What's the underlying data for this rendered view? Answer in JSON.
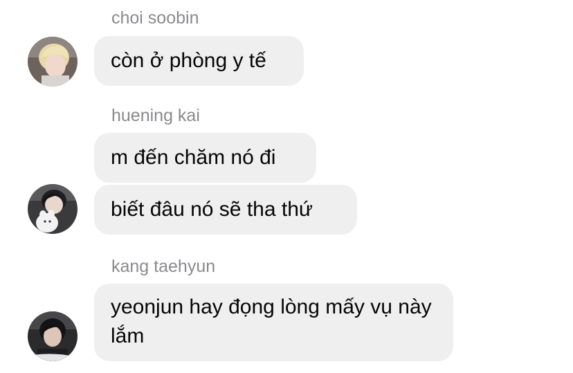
{
  "groups": [
    {
      "sender": "choi soobin",
      "messages": [
        "còn ở phòng y tế"
      ],
      "avatar": "user-avatar-photo"
    },
    {
      "sender": "huening kai",
      "messages": [
        "m đến chăm nó đi",
        "biết đâu nó sẽ tha thứ"
      ],
      "avatar": "user-avatar-photo"
    },
    {
      "sender": "kang taehyun",
      "messages": [
        "yeonjun hay đọng lòng mấy vụ này lắm"
      ],
      "avatar": "user-avatar-photo"
    }
  ],
  "colors": {
    "bubble": "#efeff0",
    "sender_name": "#8a8a8e",
    "message_text": "#050505",
    "background": "#ffffff"
  }
}
